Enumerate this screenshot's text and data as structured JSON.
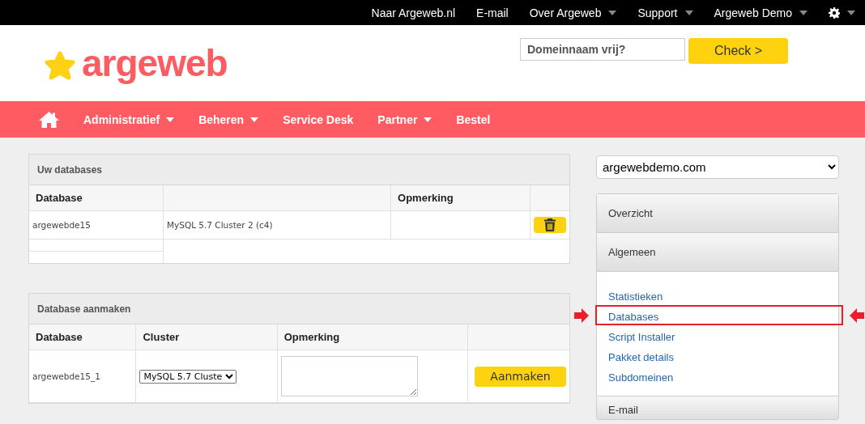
{
  "top_links": [
    {
      "label": "Naar Argeweb.nl",
      "has_menu": false
    },
    {
      "label": "E-mail",
      "has_menu": false
    },
    {
      "label": "Over Argeweb",
      "has_menu": true
    },
    {
      "label": "Support",
      "has_menu": true
    },
    {
      "label": "Argeweb Demo",
      "has_menu": true
    },
    {
      "kind": "settings",
      "has_menu": true
    }
  ],
  "logo": {
    "text": "argeweb"
  },
  "domain_search": {
    "placeholder": "Domeinnaam vrij?",
    "button": "Check >"
  },
  "nav": [
    {
      "kind": "home"
    },
    {
      "label": "Administratief",
      "has_menu": true
    },
    {
      "label": "Beheren",
      "has_menu": true
    },
    {
      "label": "Service Desk",
      "has_menu": false
    },
    {
      "label": "Partner",
      "has_menu": true
    },
    {
      "label": "Bestel",
      "has_menu": false
    }
  ],
  "databases_panel": {
    "title": "Uw databases",
    "columns": [
      "Database",
      "",
      "Opmerking",
      ""
    ],
    "rows": [
      {
        "database": "argewebde15",
        "cluster": "MySQL 5.7 Cluster 2 (c4)",
        "remark": ""
      }
    ]
  },
  "create_panel": {
    "title": "Database aanmaken",
    "columns": [
      "Database",
      "Cluster",
      "Opmerking",
      ""
    ],
    "database": "argewebde15_1",
    "cluster_value": "MySQL 5.7 Cluste",
    "button": "Aanmaken"
  },
  "sidebar": {
    "domain": "argewebdemo.com",
    "sections": [
      {
        "label": "Overzicht"
      },
      {
        "label": "Algemeen",
        "items": [
          {
            "label": "Statistieken",
            "selected": false
          },
          {
            "label": "Databases",
            "selected": true
          },
          {
            "label": "Script Installer",
            "selected": false
          },
          {
            "label": "Pakket details",
            "selected": false
          },
          {
            "label": "Subdomeinen",
            "selected": false
          }
        ]
      },
      {
        "label": "E-mail"
      }
    ]
  }
}
